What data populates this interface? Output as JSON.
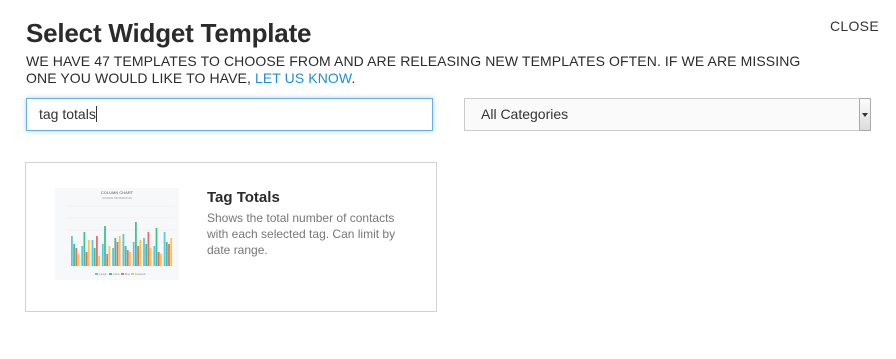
{
  "dialog": {
    "title": "Select Widget Template",
    "close_label": "CLOSE",
    "intro_text": "We have 47 templates to choose from and are releasing new templates often. If we are missing one you would like to have, ",
    "intro_link": "let us know",
    "intro_end": "."
  },
  "search": {
    "value": "tag totals"
  },
  "category_select": {
    "selected": "All Categories"
  },
  "templates": [
    {
      "title": "Tag Totals",
      "description": "Shows the total number of contacts with each selected tag. Can limit by date range.",
      "thumbnail": {
        "chart_title": "COLUMN CHART",
        "chart_subtitle": "SOURCE INFORMATION",
        "legend": [
          "Google",
          "Yahoo",
          "Bing",
          "Facebook"
        ],
        "series_colors": [
          "#5ec5e8",
          "#3cc48f",
          "#f06a6a",
          "#f5c842"
        ]
      }
    }
  ]
}
